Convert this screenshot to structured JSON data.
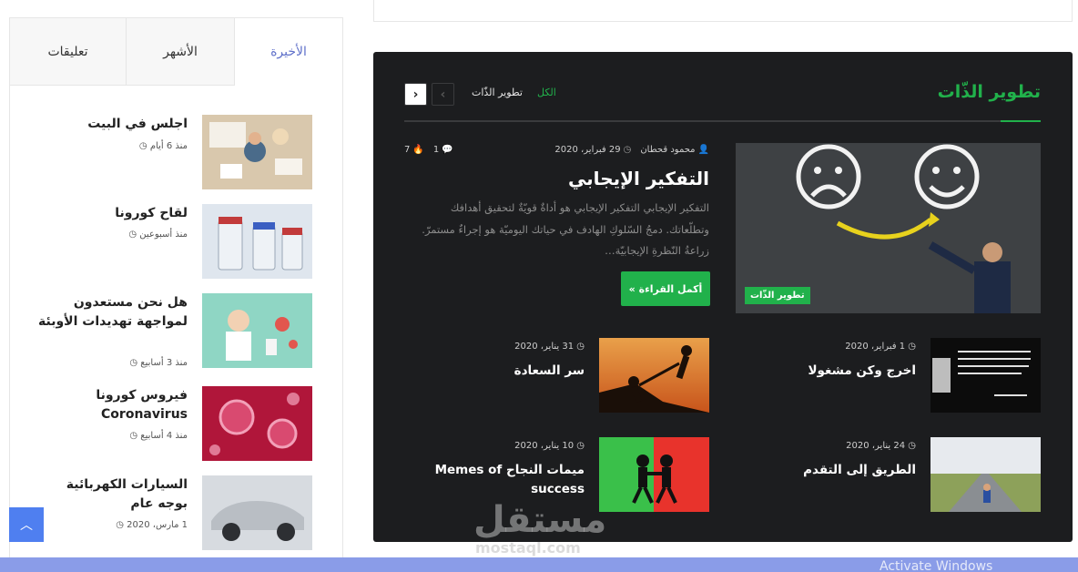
{
  "section": {
    "title": "تطوير الذّات",
    "filter_all": "الكل",
    "filter_self": "تطوير الذّات"
  },
  "featured": {
    "author": "محمود قحطان",
    "date": "29 فبراير، 2020",
    "comments": "1",
    "views": "7",
    "title": "التفكير الإيجابي",
    "excerpt": "التفكير الإيجابي التفكير الإيجابي هو أداةٌ قويّةٌ لتحقيق أهدافك وتطلّعاتك. دمجُ السّلوكِ الهادف في حياتك اليوميّة هو إجراءٌ مستمرّ. زراعةُ النّظرةِ الإيجابيّة…",
    "category": "تطوير الذّات",
    "read_more": "أكمل القراءة »"
  },
  "posts": [
    {
      "date": "1 فبراير، 2020",
      "title": "اخرج وكن مشغولا"
    },
    {
      "date": "31 يناير، 2020",
      "title": "سر السعادة"
    },
    {
      "date": "24 يناير، 2020",
      "title": "الطريق إلى التقدم"
    },
    {
      "date": "10 يناير، 2020",
      "title": "ميمات النجاح Memes of success"
    }
  ],
  "sidebar": {
    "tabs": {
      "latest": "الأخيرة",
      "popular": "الأشهر",
      "comments": "تعليقات"
    },
    "items": [
      {
        "title": "اجلس في البيت",
        "date": "منذ 6 أيام"
      },
      {
        "title": "لقاح كورونا",
        "date": "منذ أسبوعين"
      },
      {
        "title": "هل نحن مستعدون لمواجهة تهديدات الأوبئة",
        "date": "منذ 3 أسابيع"
      },
      {
        "title": "فيروس كورونا Coronavirus",
        "date": "منذ 4 أسابيع"
      },
      {
        "title": "السيارات الكهربائية بوجه عام",
        "date": "1 مارس، 2020"
      }
    ]
  },
  "watermark": {
    "ar": "مستقل",
    "en": "mostaql.com"
  },
  "os_notice": "Activate Windows",
  "colors": {
    "accent": "#21b14b",
    "tab_active": "#5e6fc9",
    "dark_bg": "#1c1d1f",
    "scroll_btn": "#4f7ff0"
  },
  "icons": [
    "user-icon",
    "clock-icon",
    "comment-icon",
    "fire-icon",
    "chevron-left-icon",
    "chevron-right-icon",
    "chevron-up-icon"
  ]
}
